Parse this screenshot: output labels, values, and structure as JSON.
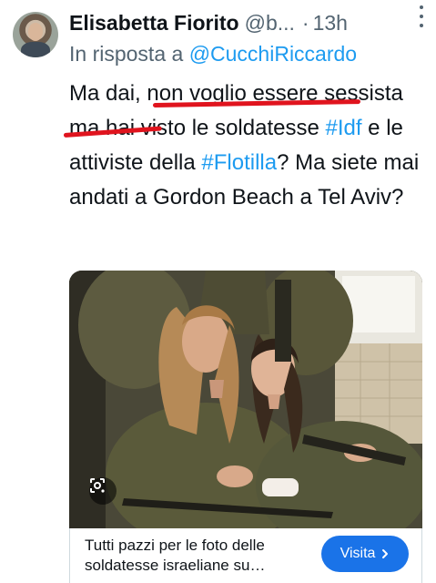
{
  "tweet": {
    "author_name": "Elisabetta Fiorito",
    "author_handle": "@b...",
    "separator": "·",
    "time": "13h",
    "reply_prefix": "In risposta a",
    "reply_to": "@CucchiRiccardo",
    "text_parts": [
      "Ma dai, non voglio essere sessista ma hai visto le soldatesse ",
      "#Idf",
      " e le attiviste della ",
      "#Flotilla",
      "? Ma siete mai andati a Gordon Beach a Tel Aviv?"
    ],
    "colors": {
      "text": "#0f1419",
      "secondary": "#536471",
      "link": "#1d9bf0",
      "underline": "#e0141e"
    }
  },
  "media": {
    "lens_icon": "google-lens-icon"
  },
  "card": {
    "title": "Tutti pazzi per le foto delle soldatesse israeliane su…",
    "button_label": "Visita",
    "button_icon": "chevron-right-icon",
    "button_color": "#1a73e8"
  },
  "icons": {
    "more": "more-vertical-icon"
  }
}
